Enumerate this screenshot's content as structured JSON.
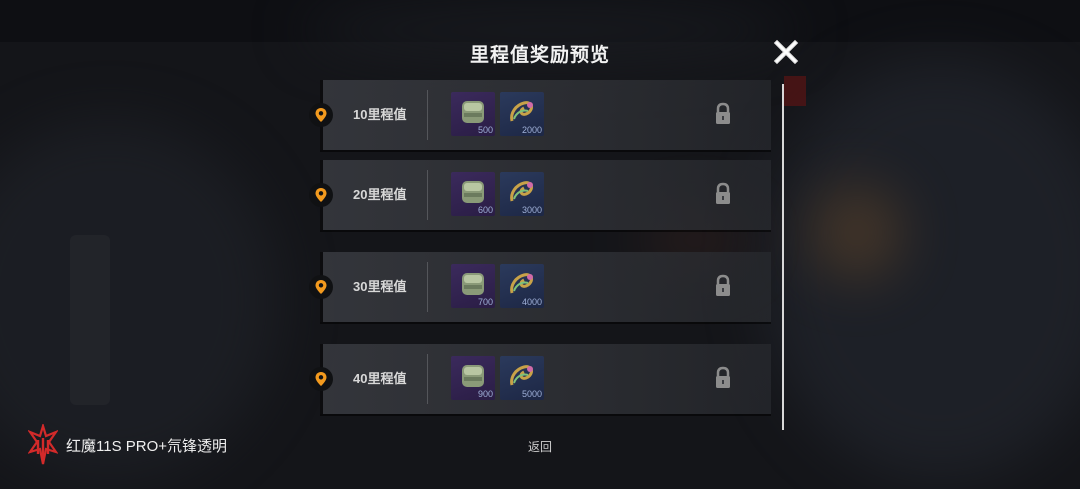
{
  "header": {
    "title": "里程值奖励预览"
  },
  "rows": [
    {
      "label": "10里程值",
      "item1_qty": "500",
      "item2_qty": "2000"
    },
    {
      "label": "20里程值",
      "item1_qty": "600",
      "item2_qty": "3000"
    },
    {
      "label": "30里程值",
      "item1_qty": "700",
      "item2_qty": "4000"
    },
    {
      "label": "40里程值",
      "item1_qty": "900",
      "item2_qty": "5000"
    }
  ],
  "footer": {
    "return_label": "返回"
  },
  "watermark": {
    "text": "红魔11S PRO+氘锋透明"
  },
  "colors": {
    "marker": "#f39a1e",
    "item_purple": "#3b2a5c",
    "item_blue": "#2b3a5c"
  },
  "icons": {
    "close": "close-icon",
    "marker": "location-pin-icon",
    "lock": "lock-icon",
    "item1": "fuel-canister-icon",
    "item2": "coil-part-icon"
  }
}
